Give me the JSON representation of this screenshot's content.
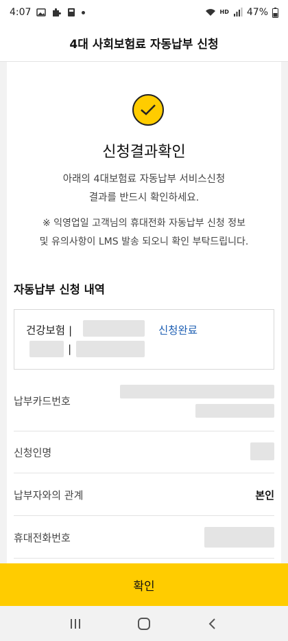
{
  "status_bar": {
    "time": "4:07",
    "battery": "47%",
    "network": "HD"
  },
  "header": {
    "title": "4대 사회보험료 자동납부 신청"
  },
  "result": {
    "title": "신청결과확인",
    "desc_line1": "아래의 4대보험료 자동납부 서비스신청",
    "desc_line2": "결과를 반드시 확인하세요.",
    "notice_line1": "※ 익영업일 고객님의 휴대전화 자동납부 신청 정보",
    "notice_line2": "및 유의사항이 LMS 발송 되오니 확인 부탁드립니다."
  },
  "section": {
    "title": "자동납부 신청 내역"
  },
  "apply_item": {
    "name": "건강보험 |",
    "status": "신청완료",
    "separator": "|"
  },
  "rows": [
    {
      "label": "납부카드번호",
      "value": ""
    },
    {
      "label": "신청인명",
      "value": ""
    },
    {
      "label": "납부자와의 관계",
      "value": "본인"
    },
    {
      "label": "휴대전화번호",
      "value": ""
    }
  ],
  "confirm_button": {
    "label": "확인"
  },
  "colors": {
    "accent": "#ffcc00",
    "link": "#1e5fb3"
  }
}
